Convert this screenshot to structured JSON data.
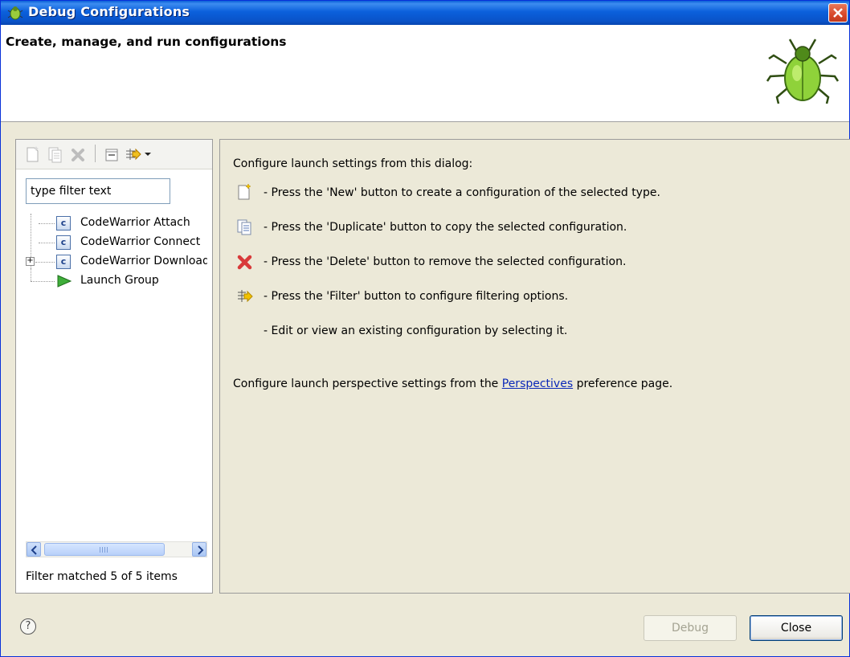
{
  "window": {
    "title": "Debug Configurations"
  },
  "banner": {
    "heading": "Create, manage, and run configurations"
  },
  "left_panel": {
    "toolbar": [
      "new-configuration",
      "duplicate",
      "delete",
      "collapse-all",
      "filter"
    ],
    "filter_placeholder": "type filter text",
    "filter_value": "type filter text",
    "tree": [
      {
        "label": "CodeWarrior Attach",
        "icon": "c-config-icon",
        "expandable": false
      },
      {
        "label": "CodeWarrior Connect",
        "icon": "c-config-icon",
        "expandable": false
      },
      {
        "label": "CodeWarrior Download",
        "icon": "c-config-icon",
        "expandable": true
      },
      {
        "label": "Launch Group",
        "icon": "launch-group-icon",
        "expandable": false
      }
    ],
    "filter_status": "Filter matched 5 of 5 items"
  },
  "right_panel": {
    "intro": "Configure launch settings from this dialog:",
    "items": [
      {
        "icon": "new-config-icon",
        "text": "- Press the 'New' button to create a configuration of the selected type."
      },
      {
        "icon": "duplicate-icon",
        "text": "- Press the 'Duplicate' button to copy the selected configuration."
      },
      {
        "icon": "delete-icon",
        "text": "- Press the 'Delete' button to remove the selected configuration."
      },
      {
        "icon": "filter-icon",
        "text": "- Press the 'Filter' button to configure filtering options."
      },
      {
        "icon": "",
        "text": "- Edit or view an existing configuration by selecting it."
      }
    ],
    "perspective_prefix": "Configure launch perspective settings from the ",
    "perspective_link": "Perspectives",
    "perspective_suffix": " preference page."
  },
  "buttons": {
    "help": "?",
    "debug": "Debug",
    "close": "Close"
  },
  "colors": {
    "titlebar": "#0a53c8",
    "dialog_bg": "#ece9d8",
    "link": "#0a28b8",
    "delete_red": "#d83a3a"
  }
}
